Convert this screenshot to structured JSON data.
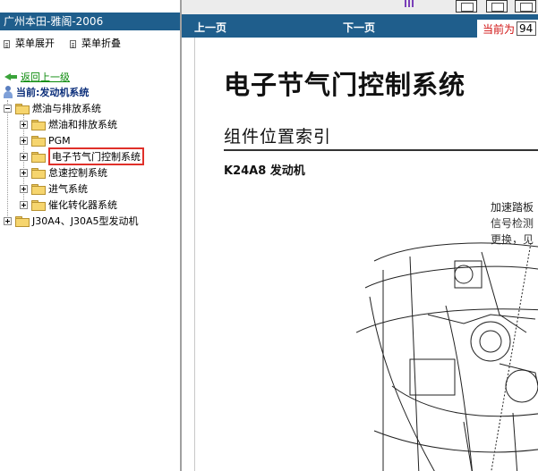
{
  "left_panel": {
    "title": "广州本田-雅阁-2006",
    "expand_label": "菜单展开",
    "collapse_label": "菜单折叠",
    "back_label": "返回上一级",
    "current_label": "当前:发动机系统",
    "tree": [
      {
        "label": "燃油与排放系统",
        "expanded": true
      },
      {
        "label": "燃油和排放系统"
      },
      {
        "label": "PGM"
      },
      {
        "label": "电子节气门控制系统",
        "selected": true
      },
      {
        "label": "怠速控制系统"
      },
      {
        "label": "进气系统"
      },
      {
        "label": "催化转化器系统"
      },
      {
        "label": "J30A4、J30A5型发动机"
      }
    ]
  },
  "nav": {
    "prev_label": "上一页",
    "next_label": "下一页",
    "page_label": "当前为",
    "page_value": "94"
  },
  "document": {
    "title": "电子节气门控制系统",
    "subtitle": "组件位置索引",
    "engine": "K24A8 发动机",
    "callout_line1": "加速踏板",
    "callout_line2": "信号检测",
    "callout_line3": "更换，见"
  },
  "colors": {
    "header_bg": "#1f5e8c",
    "highlight_border": "#e0302a",
    "back_link": "#0a8a0a",
    "page_label": "#d01010"
  }
}
